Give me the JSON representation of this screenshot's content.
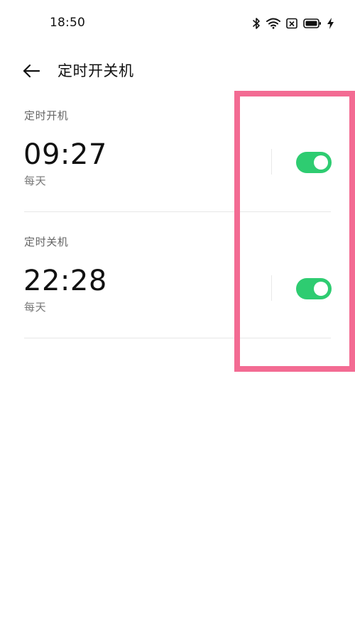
{
  "status_bar": {
    "time": "18:50",
    "icons": [
      "bluetooth-icon",
      "wifi-icon",
      "sim-off-icon",
      "battery-icon",
      "charging-icon"
    ]
  },
  "header": {
    "title": "定时开关机",
    "back_icon": "arrow-left-icon"
  },
  "schedules": [
    {
      "label": "定时开机",
      "time": "09:27",
      "repeat": "每天",
      "enabled": true
    },
    {
      "label": "定时关机",
      "time": "22:28",
      "repeat": "每天",
      "enabled": true
    }
  ],
  "colors": {
    "toggle_on": "#2ecc71",
    "highlight": "#f36b93",
    "background": "#ffffff"
  }
}
